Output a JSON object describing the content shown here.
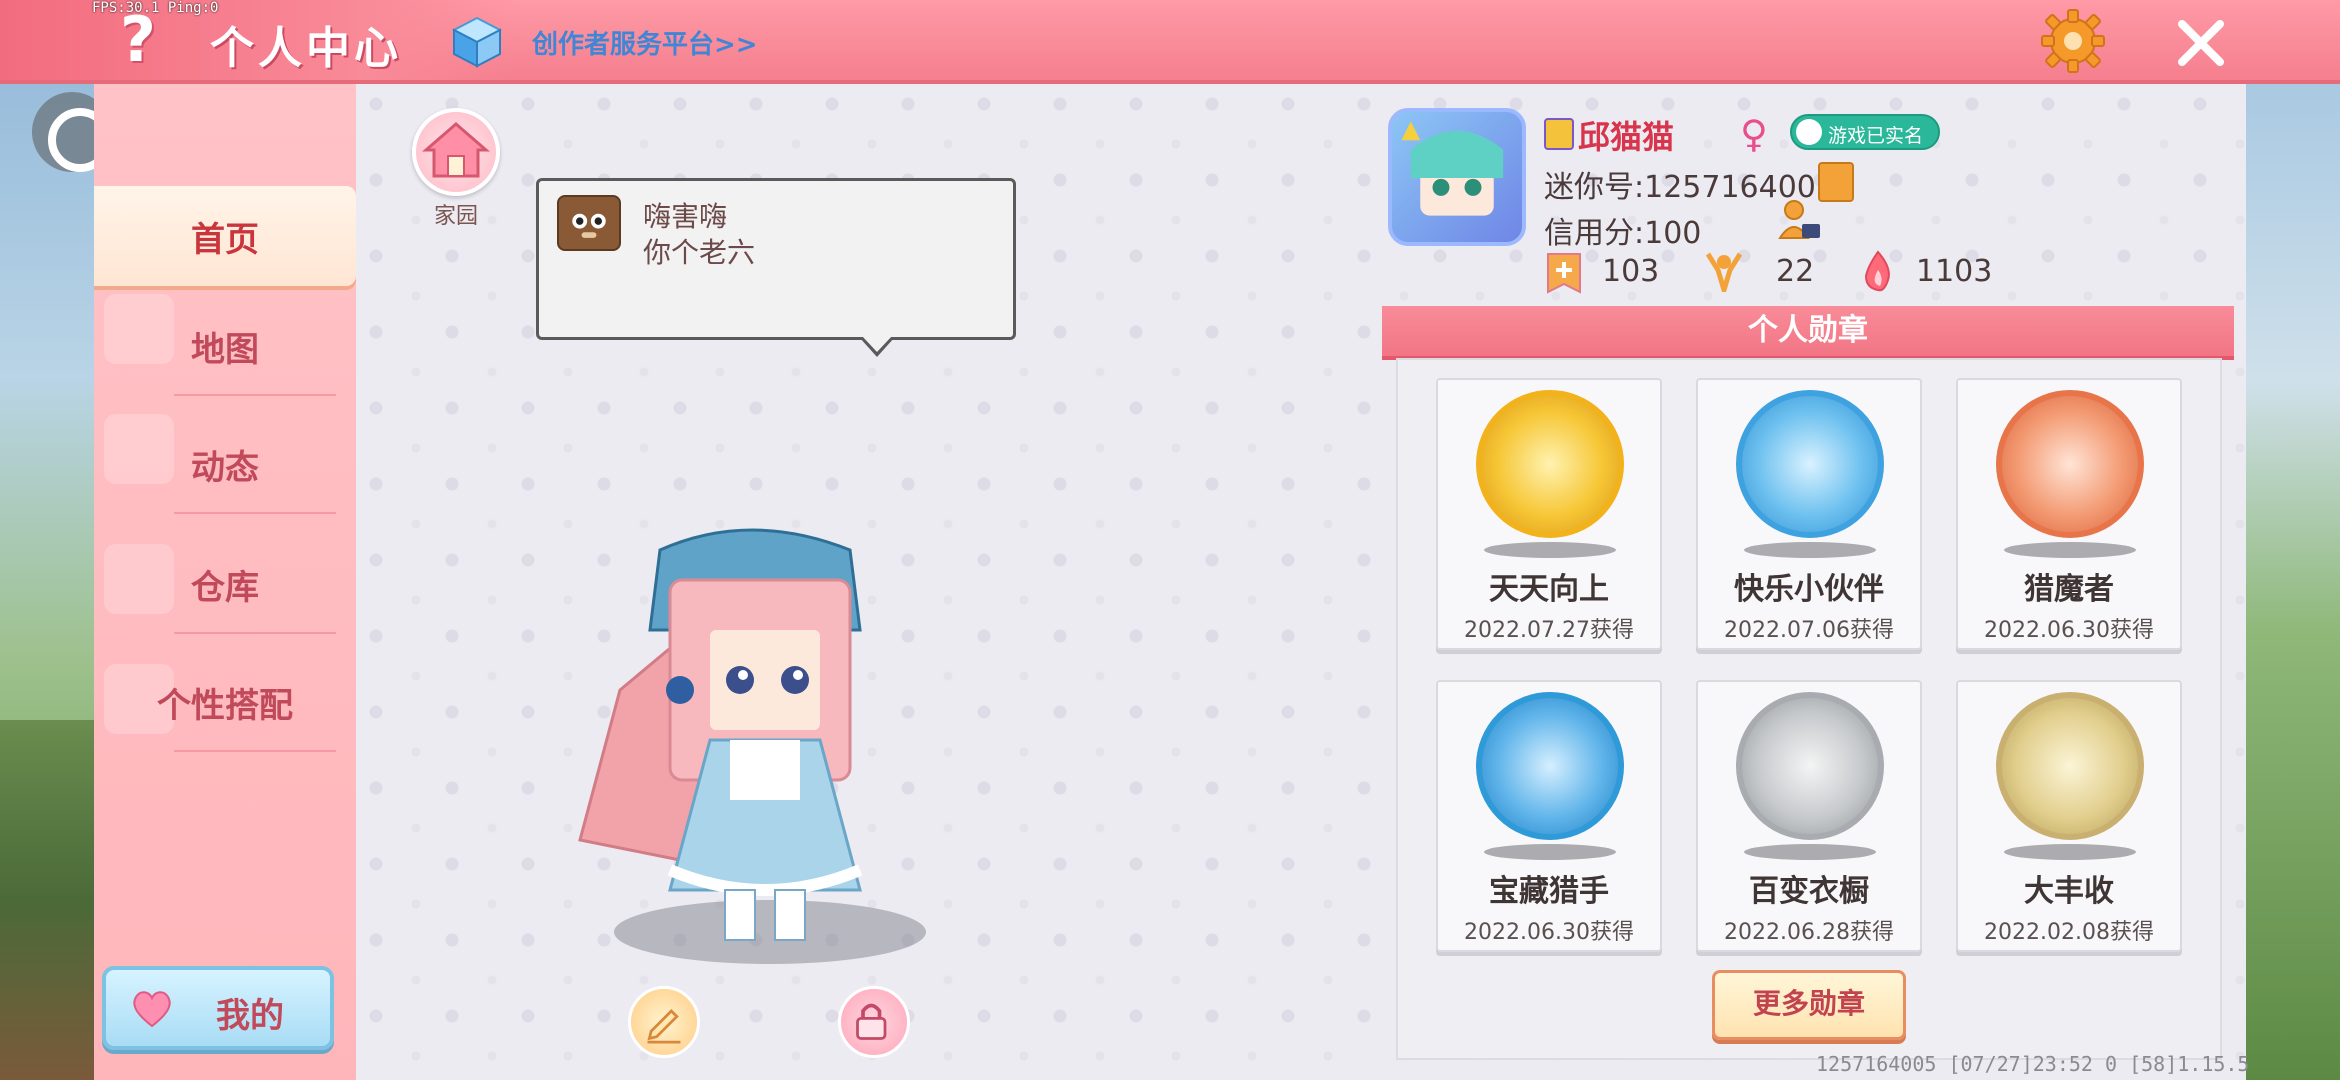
{
  "debug": {
    "fps_text": "FPS:30.1 Ping:0"
  },
  "header": {
    "help_glyph": "?",
    "title": "个人中心",
    "creator_link": "创作者服务平台>>",
    "settings_icon": "gear-icon",
    "close_icon": "close-icon"
  },
  "sidebar": {
    "items": [
      {
        "label": "首页",
        "active": true
      },
      {
        "label": "地图",
        "active": false
      },
      {
        "label": "动态",
        "active": false
      },
      {
        "label": "仓库",
        "active": false
      },
      {
        "label": "个性搭配",
        "active": false
      }
    ],
    "mine_label": "我的"
  },
  "home": {
    "label": "家园"
  },
  "speech": {
    "line1": "嗨害嗨",
    "line2": "你个老六"
  },
  "profile": {
    "username": "邱猫猫",
    "gender": "♀",
    "realname_badge": "游戏已实名",
    "mini_id": "迷你号:1257164005",
    "credit": "信用分:100",
    "stats": [
      {
        "icon": "plus-flag-icon",
        "value": "103"
      },
      {
        "icon": "cheer-icon",
        "value": "22"
      },
      {
        "icon": "flame-icon",
        "value": "1103"
      }
    ]
  },
  "badges": {
    "title": "个人勋章",
    "items": [
      {
        "name": "天天向上",
        "date": "2022.07.27获得",
        "color": "#f2b21c"
      },
      {
        "name": "快乐小伙伴",
        "date": "2022.07.06获得",
        "color": "#3ea2e0"
      },
      {
        "name": "猎魔者",
        "date": "2022.06.30获得",
        "color": "#e8754a"
      },
      {
        "name": "宝藏猎手",
        "date": "2022.06.30获得",
        "color": "#2f9ad8"
      },
      {
        "name": "百变衣橱",
        "date": "2022.06.28获得",
        "color": "#a8acb0"
      },
      {
        "name": "大丰收",
        "date": "2022.02.08获得",
        "color": "#c9b070"
      }
    ],
    "more_label": "更多勋章"
  },
  "footer": {
    "info": "1257164005 [07/27]23:52 0 [58]1.15.5"
  },
  "colors": {
    "accent": "#f57f8e",
    "title_red": "#c04a5a",
    "link_blue": "#3f86d6"
  }
}
